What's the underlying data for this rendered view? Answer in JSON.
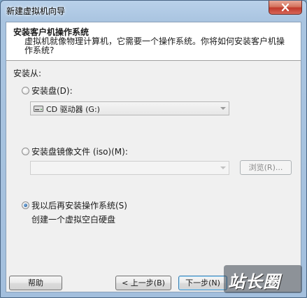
{
  "window": {
    "title": "新建虚拟机向导"
  },
  "header": {
    "title": "安装客户机操作系统",
    "description": "虚拟机就像物理计算机，它需要一个操作系统。你将如何安装客户机操作系统?"
  },
  "install_from_label": "安装从:",
  "options": {
    "disc": {
      "label": "安装盘(D):",
      "selected": false,
      "drive_value": "CD 驱动器 (G:)"
    },
    "iso": {
      "label": "安装盘镜像文件 (iso)(M):",
      "selected": false,
      "path_value": "",
      "browse_label": "浏览(R)..."
    },
    "later": {
      "label": "我以后再安装操作系统(S)",
      "selected": true,
      "note": "创建一个虚拟空白硬盘"
    }
  },
  "footer": {
    "help_label": "帮助",
    "back_label": "< 上一步(B)",
    "next_label": "下一步(N)"
  },
  "watermark": {
    "text": "站长圈"
  }
}
